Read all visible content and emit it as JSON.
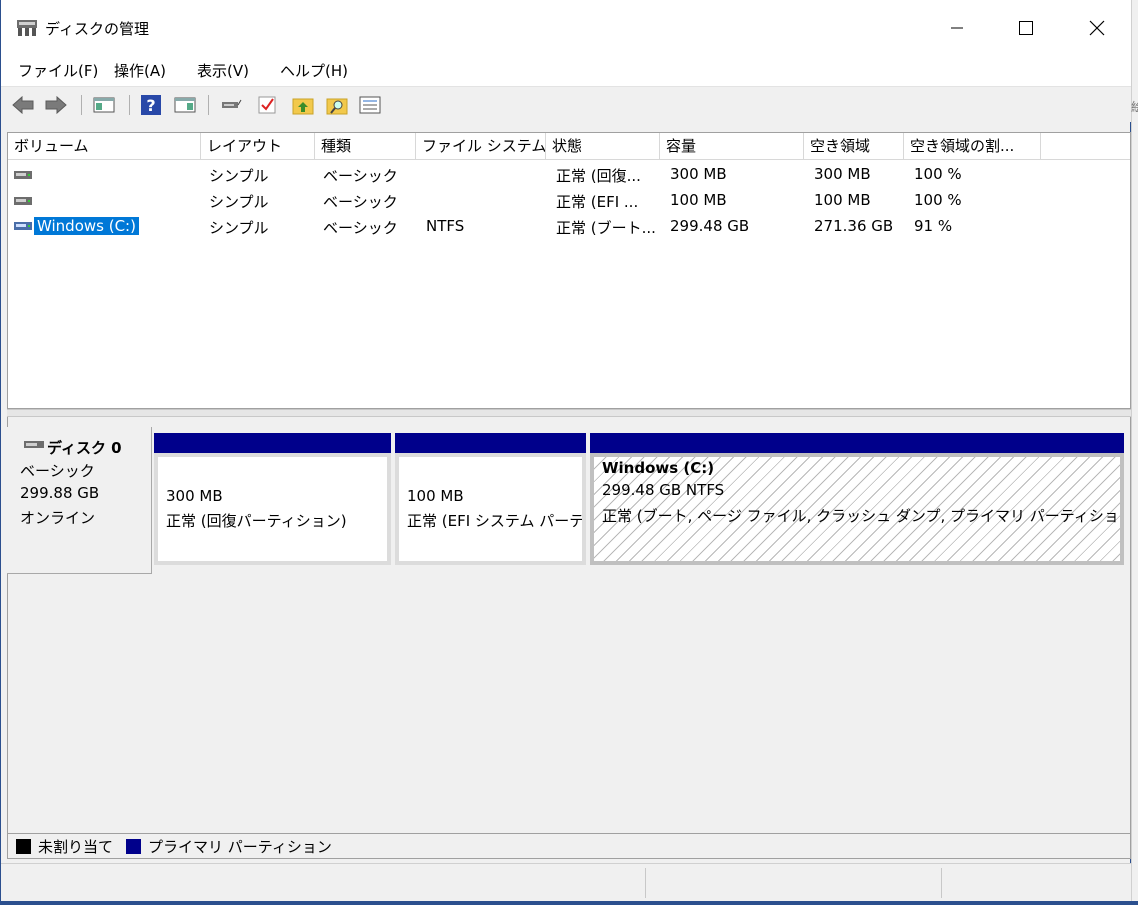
{
  "window": {
    "title": "ディスクの管理",
    "minimize_icon": "minimize-icon",
    "maximize_icon": "maximize-icon",
    "close_icon": "close-icon"
  },
  "menu": [
    "ファイル(F)",
    "操作(A)",
    "表示(V)",
    "ヘルプ(H)"
  ],
  "toolbar_icons": [
    "back-arrow-icon",
    "forward-arrow-icon",
    "console-tree-icon",
    "help-icon",
    "action-pane-icon",
    "connect-drive-icon",
    "check-icon",
    "folder-up-icon",
    "folder-search-icon",
    "properties-list-icon"
  ],
  "volume_list": {
    "columns": [
      "ボリューム",
      "レイアウト",
      "種類",
      "ファイル システム",
      "状態",
      "容量",
      "空き領域",
      "空き領域の割..."
    ],
    "rows": [
      {
        "volume": "",
        "layout": "シンプル",
        "type": "ベーシック",
        "fs": "",
        "status": "正常 (回復...",
        "capacity": "300 MB",
        "free": "300 MB",
        "pct": "100 %"
      },
      {
        "volume": "",
        "layout": "シンプル",
        "type": "ベーシック",
        "fs": "",
        "status": "正常 (EFI ...",
        "capacity": "100 MB",
        "free": "100 MB",
        "pct": "100 %"
      },
      {
        "volume": "Windows (C:)",
        "layout": "シンプル",
        "type": "ベーシック",
        "fs": "NTFS",
        "status": "正常 (ブート...",
        "capacity": "299.48 GB",
        "free": "271.36 GB",
        "pct": "91 %"
      }
    ]
  },
  "disk": {
    "name": "ディスク 0",
    "type": "ベーシック",
    "size": "299.88 GB",
    "state": "オンライン",
    "partitions": [
      {
        "title": "",
        "size": "300 MB",
        "status": "正常 (回復パーティション)"
      },
      {
        "title": "",
        "size": "100 MB",
        "status": "正常 (EFI システム パーテ"
      },
      {
        "title": "Windows  (C:)",
        "size": "299.48 GB NTFS",
        "status": "正常 (ブート, ページ ファイル, クラッシュ ダンプ, プライマリ パーティション)"
      }
    ]
  },
  "legend": [
    {
      "label": "未割り当て",
      "color": "#000000"
    },
    {
      "label": "プライマリ パーティション",
      "color": "#00008b"
    }
  ],
  "colors": {
    "primary_partition": "#00008b",
    "selection": "#0078d7"
  }
}
